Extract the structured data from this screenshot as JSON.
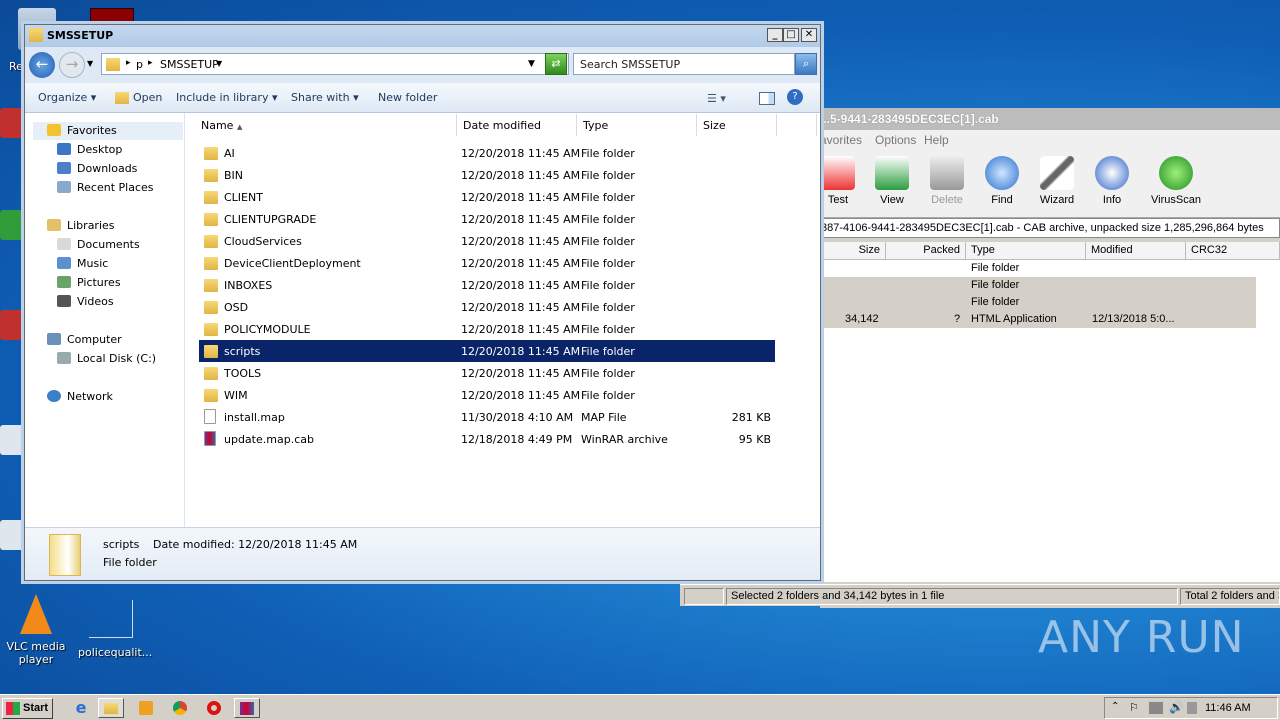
{
  "desktop": {
    "icons": [
      {
        "label": "VLC media player"
      },
      {
        "label": "policequalit..."
      }
    ],
    "watermark": "ANY RUN",
    "partial_label_re": "Re"
  },
  "winrar": {
    "title": "...5-9441-283495DEC3EC[1].cab",
    "menu": [
      "avorites",
      "Options",
      "Help"
    ],
    "tools": [
      {
        "label": "Test",
        "icon": "test-icon"
      },
      {
        "label": "View",
        "icon": "book-icon"
      },
      {
        "label": "Delete",
        "icon": "trash-icon"
      },
      {
        "label": "Find",
        "icon": "magnifier-icon"
      },
      {
        "label": "Wizard",
        "icon": "wand-icon"
      },
      {
        "label": "Info",
        "icon": "info-icon"
      },
      {
        "label": "VirusScan",
        "icon": "bug-icon"
      }
    ],
    "path": "387-4106-9441-283495DEC3EC[1].cab - CAB archive, unpacked size 1,285,296,864 bytes",
    "columns": [
      "Size",
      "Packed",
      "Type",
      "Modified",
      "CRC32"
    ],
    "rows": [
      {
        "size": "",
        "packed": "",
        "type": "File folder",
        "modified": ""
      },
      {
        "size": "",
        "packed": "",
        "type": "File folder",
        "modified": ""
      },
      {
        "size": "",
        "packed": "",
        "type": "File folder",
        "modified": ""
      },
      {
        "size": "34,142",
        "packed": "?",
        "type": "HTML Application",
        "modified": "12/13/2018 5:0..."
      }
    ],
    "status_left": "Selected 2 folders and 34,142 bytes in 1 file",
    "status_right": "Total 2 folders and 3"
  },
  "explorer": {
    "title": "SMSSETUP",
    "breadcrumb": [
      "p",
      "SMSSETUP"
    ],
    "search_placeholder": "Search SMSSETUP",
    "toolbar": {
      "organize": "Organize",
      "open": "Open",
      "include": "Include in library",
      "share": "Share with",
      "new_folder": "New folder"
    },
    "nav": {
      "favorites": "Favorites",
      "fav_items": [
        "Desktop",
        "Downloads",
        "Recent Places"
      ],
      "libraries": "Libraries",
      "lib_items": [
        "Documents",
        "Music",
        "Pictures",
        "Videos"
      ],
      "computer": "Computer",
      "comp_items": [
        "Local Disk (C:)"
      ],
      "network": "Network"
    },
    "columns": {
      "name": "Name",
      "date": "Date modified",
      "type": "Type",
      "size": "Size"
    },
    "files": [
      {
        "name": "AI",
        "date": "12/20/2018 11:45 AM",
        "type": "File folder",
        "size": ""
      },
      {
        "name": "BIN",
        "date": "12/20/2018 11:45 AM",
        "type": "File folder",
        "size": ""
      },
      {
        "name": "CLIENT",
        "date": "12/20/2018 11:45 AM",
        "type": "File folder",
        "size": ""
      },
      {
        "name": "CLIENTUPGRADE",
        "date": "12/20/2018 11:45 AM",
        "type": "File folder",
        "size": ""
      },
      {
        "name": "CloudServices",
        "date": "12/20/2018 11:45 AM",
        "type": "File folder",
        "size": ""
      },
      {
        "name": "DeviceClientDeployment",
        "date": "12/20/2018 11:45 AM",
        "type": "File folder",
        "size": ""
      },
      {
        "name": "INBOXES",
        "date": "12/20/2018 11:45 AM",
        "type": "File folder",
        "size": ""
      },
      {
        "name": "OSD",
        "date": "12/20/2018 11:45 AM",
        "type": "File folder",
        "size": ""
      },
      {
        "name": "POLICYMODULE",
        "date": "12/20/2018 11:45 AM",
        "type": "File folder",
        "size": ""
      },
      {
        "name": "scripts",
        "date": "12/20/2018 11:45 AM",
        "type": "File folder",
        "size": ""
      },
      {
        "name": "TOOLS",
        "date": "12/20/2018 11:45 AM",
        "type": "File folder",
        "size": ""
      },
      {
        "name": "WIM",
        "date": "12/20/2018 11:45 AM",
        "type": "File folder",
        "size": ""
      },
      {
        "name": "install.map",
        "date": "11/30/2018 4:10 AM",
        "type": "MAP File",
        "size": "281 KB"
      },
      {
        "name": "update.map.cab",
        "date": "12/18/2018 4:49 PM",
        "type": "WinRAR archive",
        "size": "95 KB"
      }
    ],
    "selected_index": 9,
    "details": {
      "name": "scripts",
      "date_label": "Date modified: 12/20/2018 11:45 AM",
      "type": "File folder"
    }
  },
  "taskbar": {
    "start": "Start",
    "clock": "11:46 AM"
  }
}
